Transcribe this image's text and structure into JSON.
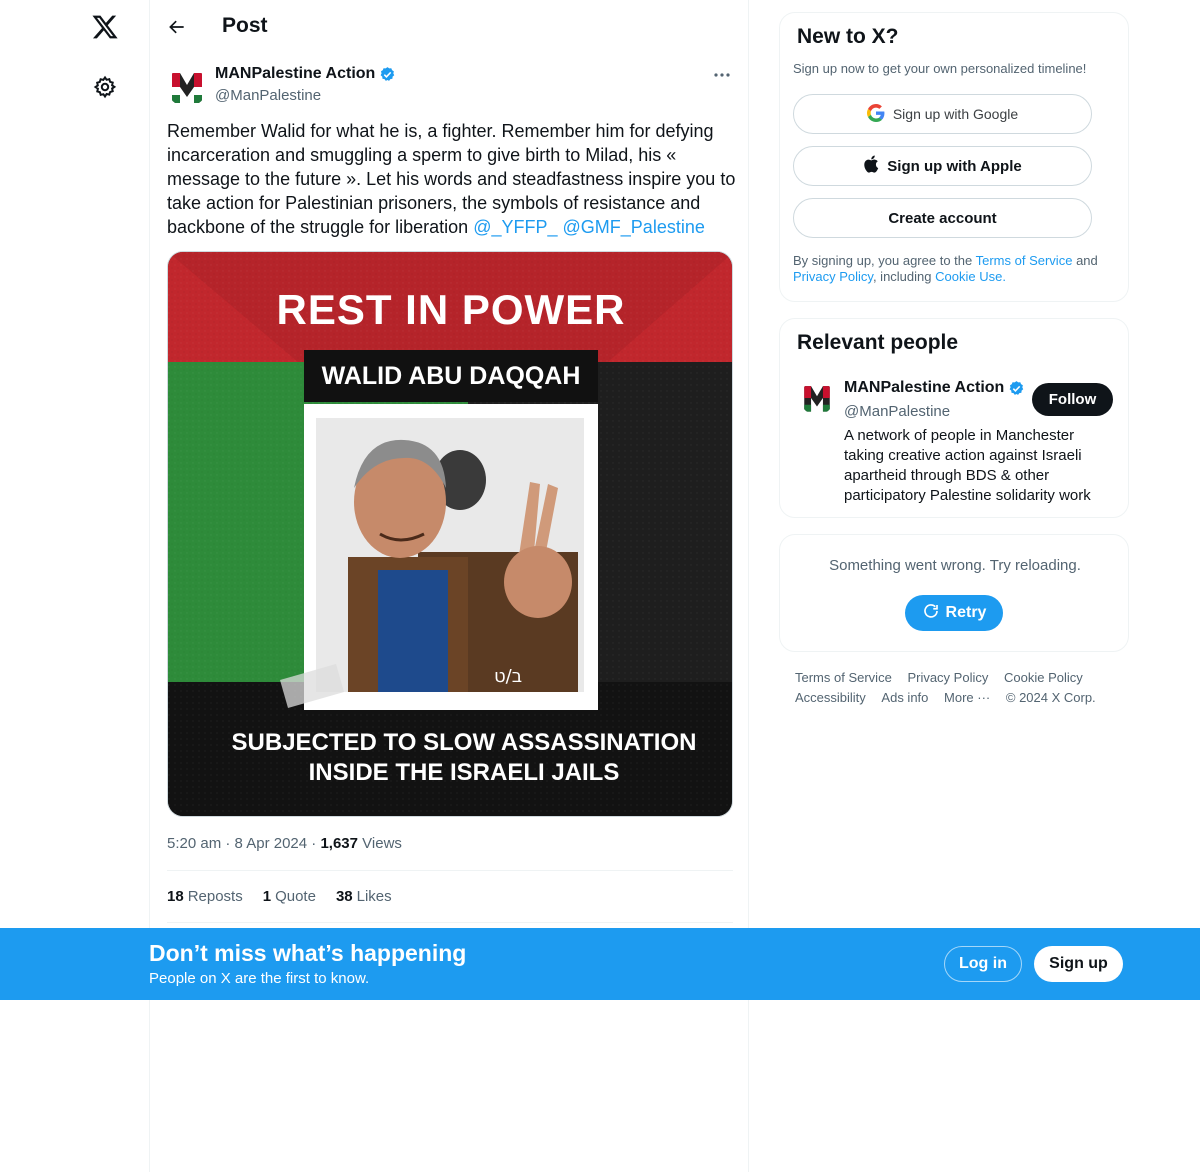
{
  "header": {
    "title": "Post"
  },
  "post": {
    "author_name": "MANPalestine Action",
    "author_handle": "@ManPalestine",
    "text": "Remember Walid for what he is, a fighter. Remember him for defying incarceration and smuggling a sperm to give birth to Milad, his « message to the future ». Let his words and steadfastness inspire you to take action for Palestinian prisoners, the symbols of resistance and backbone of the struggle for liberation",
    "mentions": [
      "@_YFFP_",
      "@GMF_Palestine"
    ],
    "image": {
      "headline": "REST IN POWER",
      "name_banner": "WALID ABU DAQQAH",
      "caption_line1": "SUBJECTED TO SLOW ASSASSINATION",
      "caption_line2": "INSIDE THE ISRAELI JAILS",
      "jacket_mark": "ב/ט"
    },
    "time": "5:20 am",
    "date": "8 Apr 2024",
    "separator": "·",
    "views_count": "1,637",
    "views_label": "Views",
    "reposts_count": "18",
    "reposts_label": "Reposts",
    "quotes_count": "1",
    "quotes_label": "Quote",
    "likes_count": "38",
    "likes_label": "Likes"
  },
  "signup_card": {
    "title": "New to X?",
    "subtitle": "Sign up now to get your own personalized timeline!",
    "google_label": "Sign up with Google",
    "apple_label": "Sign up with Apple",
    "create_label": "Create account",
    "legal_prefix": "By signing up, you agree to the",
    "terms_link": "Terms of Service",
    "legal_and": "and",
    "privacy_link": "Privacy Policy",
    "legal_including": ", including",
    "cookie_link": "Cookie Use."
  },
  "relevant_people": {
    "title": "Relevant people",
    "name": "MANPalestine Action",
    "handle": "@ManPalestine",
    "bio": "A network of people in Manchester taking creative action against Israeli apartheid through BDS & other participatory Palestine solidarity work",
    "follow_label": "Follow"
  },
  "error_card": {
    "message": "Something went wrong. Try reloading.",
    "retry_label": "Retry"
  },
  "footer": {
    "links": [
      "Terms of Service",
      "Privacy Policy",
      "Cookie Policy",
      "Accessibility",
      "Ads info",
      "More ···"
    ],
    "copyright": "© 2024 X Corp."
  },
  "bottom_bar": {
    "title": "Don’t miss what’s happening",
    "subtitle": "People on X are the first to know.",
    "login_label": "Log in",
    "signup_label": "Sign up"
  },
  "colors": {
    "accent": "#1d9bf0",
    "text": "#0f1419",
    "muted": "#536471",
    "border": "#eff3f4"
  },
  "icons": [
    "x-logo-icon",
    "gear-icon",
    "back-arrow-icon",
    "more-icon",
    "verified-badge-icon",
    "google-icon",
    "apple-icon",
    "retry-icon"
  ]
}
